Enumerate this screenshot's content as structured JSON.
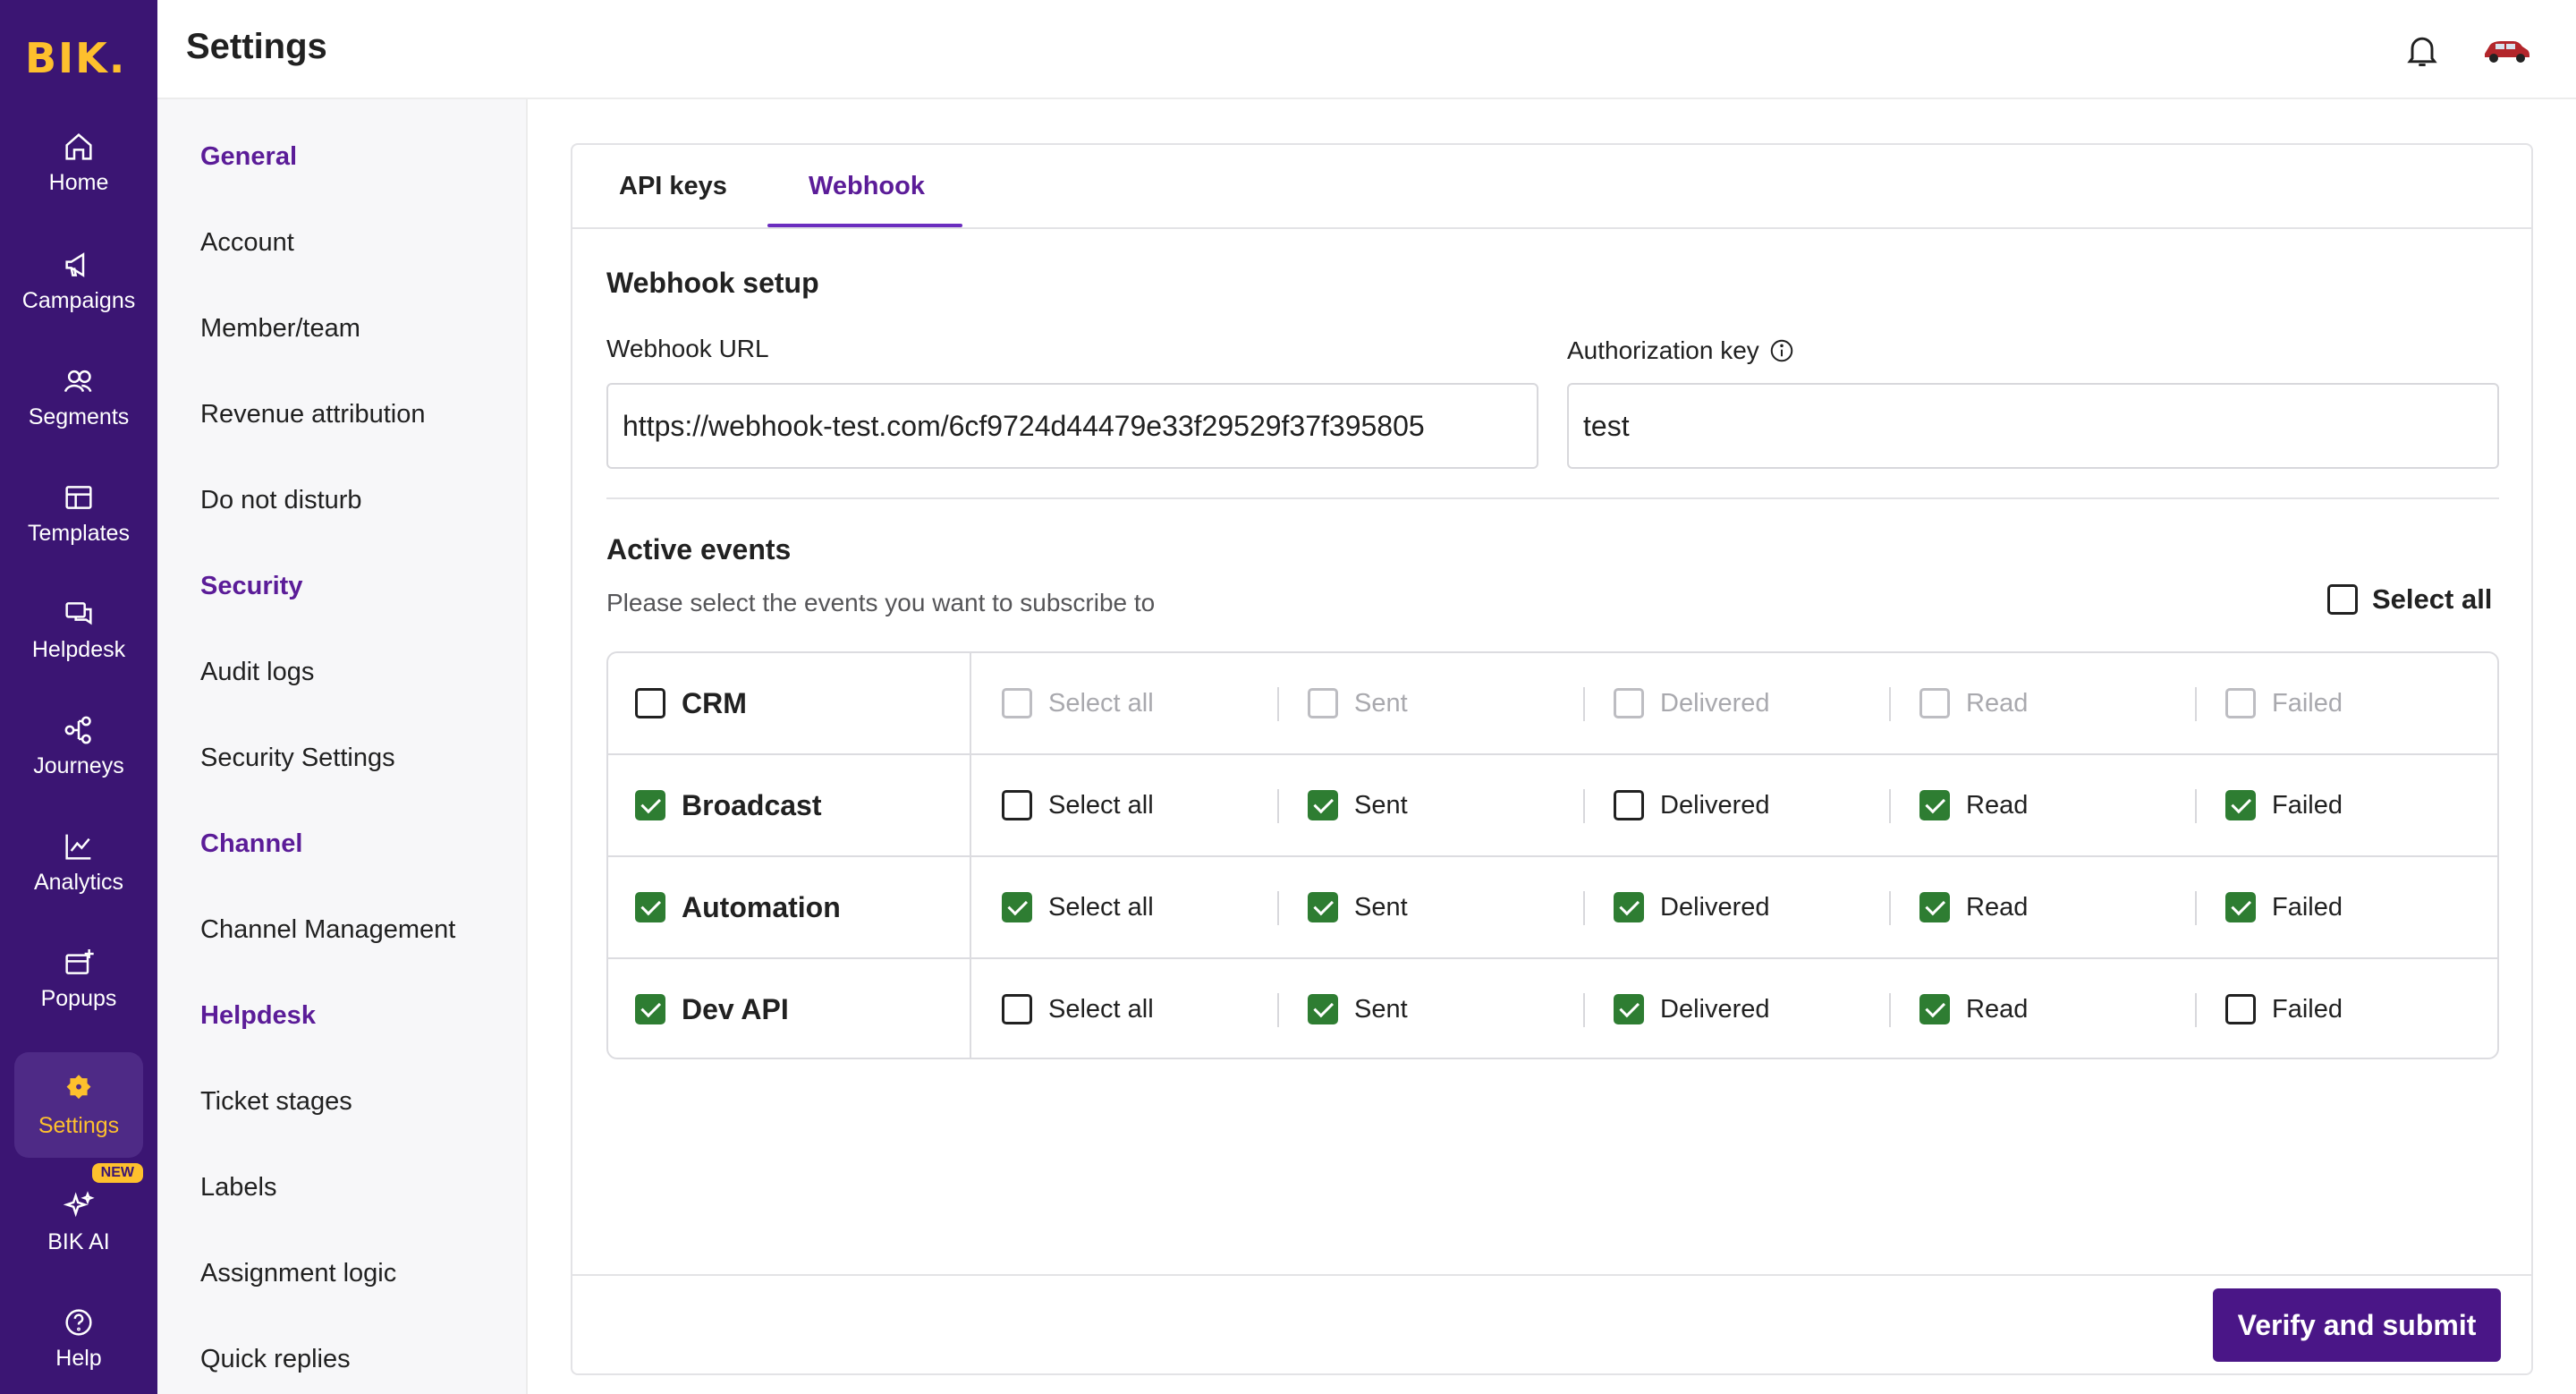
{
  "app": {
    "logo_text": "BIK.",
    "page_title": "Settings"
  },
  "rail": {
    "items": [
      {
        "label": "Home",
        "icon": "home-icon"
      },
      {
        "label": "Campaigns",
        "icon": "megaphone-icon"
      },
      {
        "label": "Segments",
        "icon": "users-icon"
      },
      {
        "label": "Templates",
        "icon": "template-icon"
      },
      {
        "label": "Helpdesk",
        "icon": "chat-icon"
      },
      {
        "label": "Journeys",
        "icon": "flow-icon"
      },
      {
        "label": "Analytics",
        "icon": "chart-icon"
      },
      {
        "label": "Popups",
        "icon": "popup-icon"
      },
      {
        "label": "Settings",
        "icon": "gear-icon",
        "active": true
      },
      {
        "label": "BIK AI",
        "icon": "sparkle-icon",
        "badge": "NEW"
      },
      {
        "label": "Help",
        "icon": "help-icon"
      }
    ]
  },
  "settings_nav": {
    "general": "General",
    "account": "Account",
    "member_team": "Member/team",
    "revenue_attribution": "Revenue attribution",
    "do_not_disturb": "Do not disturb",
    "security": "Security",
    "audit_logs": "Audit logs",
    "security_settings": "Security Settings",
    "channel": "Channel",
    "channel_management": "Channel Management",
    "helpdesk": "Helpdesk",
    "ticket_stages": "Ticket stages",
    "labels": "Labels",
    "assignment_logic": "Assignment logic",
    "quick_replies": "Quick replies"
  },
  "tabs": {
    "api_keys": "API keys",
    "webhook": "Webhook",
    "active": "webhook"
  },
  "webhook": {
    "section_title": "Webhook setup",
    "url_label": "Webhook URL",
    "url_value": "https://webhook-test.com/6cf9724d44479e33f29529f37f395805",
    "auth_label": "Authorization key",
    "auth_value": "test"
  },
  "events": {
    "section_title": "Active events",
    "hint": "Please select the events you want to subscribe to",
    "select_all_label": "Select all",
    "select_all_checked": false,
    "column_labels": [
      "Select all",
      "Sent",
      "Delivered",
      "Read",
      "Failed"
    ],
    "rows": [
      {
        "name": "CRM",
        "checked": false,
        "disabled_cols": true,
        "cols": [
          false,
          false,
          false,
          false,
          false
        ]
      },
      {
        "name": "Broadcast",
        "checked": true,
        "disabled_cols": false,
        "cols": [
          false,
          true,
          false,
          true,
          true
        ]
      },
      {
        "name": "Automation",
        "checked": true,
        "disabled_cols": false,
        "cols": [
          true,
          true,
          true,
          true,
          true
        ]
      },
      {
        "name": "Dev API",
        "checked": true,
        "disabled_cols": false,
        "cols": [
          false,
          true,
          true,
          true,
          false
        ]
      }
    ]
  },
  "footer": {
    "submit_label": "Verify and submit"
  },
  "colors": {
    "rail_bg": "#3b1573",
    "accent": "#fec02d",
    "brand_purple": "#5b1c98",
    "checkbox_green": "#2e7d32",
    "button_bg": "#4a1687"
  }
}
